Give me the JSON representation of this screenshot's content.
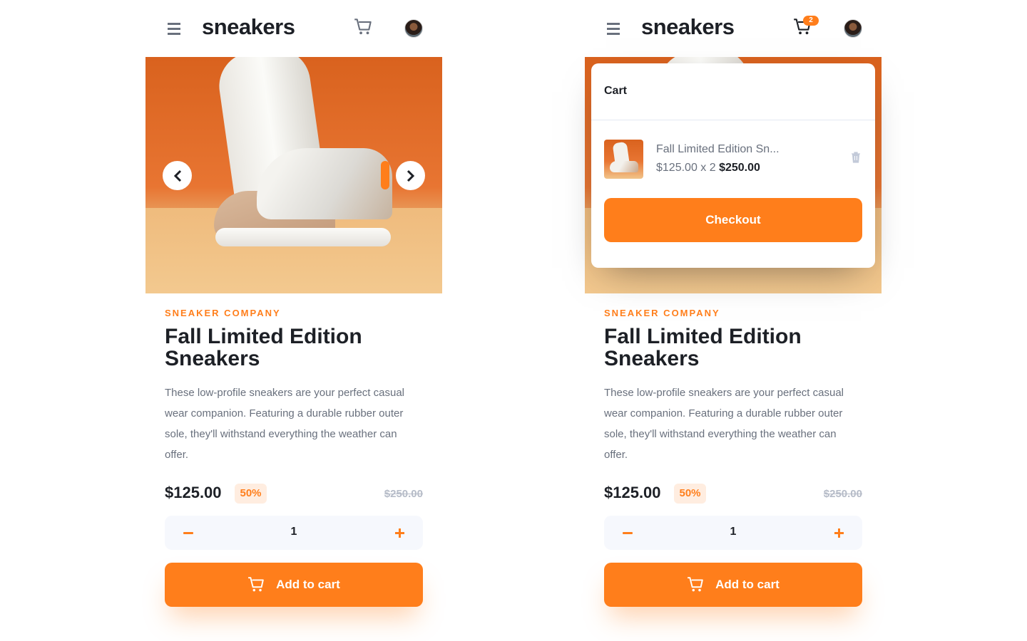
{
  "brand": {
    "logo_text": "sneakers",
    "accent": "#ff7e1b",
    "dark": "#1d2026",
    "muted": "#69707d"
  },
  "product": {
    "company": "SNEAKER COMPANY",
    "title_line1": "Fall Limited Edition",
    "title_line2": "Sneakers",
    "description": "These low-profile sneakers are your perfect casual wear companion. Featuring a durable rubber outer sole, they'll withstand everything the weather can offer.",
    "price": "$125.00",
    "discount": "50%",
    "original_price": "$250.00"
  },
  "quantity": {
    "value": "1"
  },
  "buttons": {
    "add_to_cart": "Add to cart",
    "checkout": "Checkout"
  },
  "icons": {
    "menu": "hamburger-icon",
    "cart": "cart-icon",
    "prev": "chevron-left-icon",
    "next": "chevron-right-icon",
    "delete": "trash-icon",
    "minus": "minus-icon",
    "plus": "plus-icon"
  },
  "cart": {
    "badge_count": "2",
    "title": "Cart",
    "item_name": "Fall Limited Edition Sn...",
    "item_calc": "$125.00 x 2",
    "item_total": "$250.00"
  }
}
